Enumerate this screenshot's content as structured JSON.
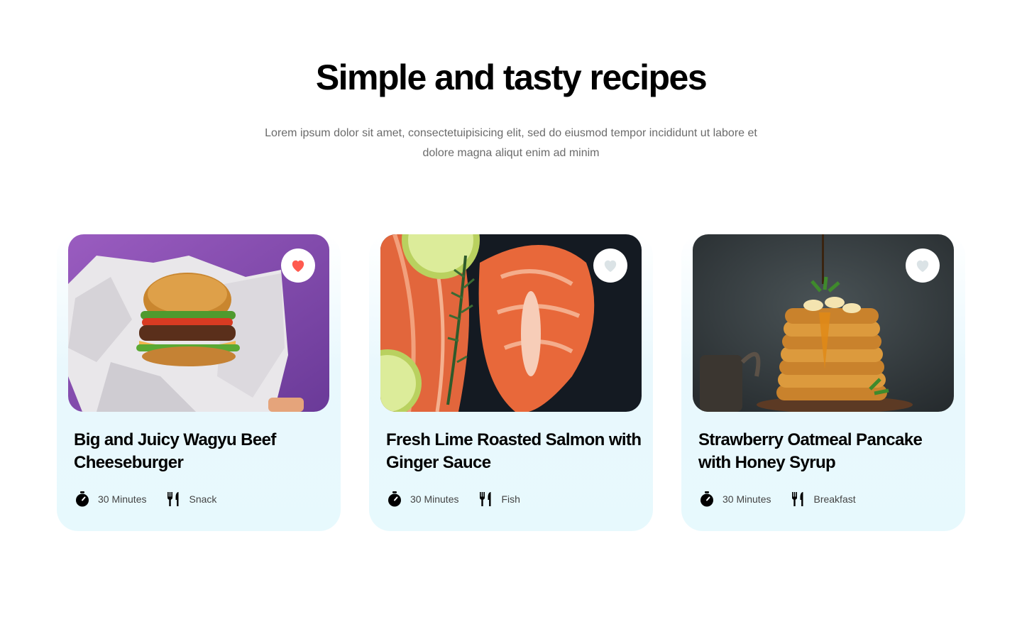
{
  "section": {
    "title": "Simple and tasty recipes",
    "subtitle": "Lorem ipsum dolor sit amet, consectetuipisicing elit, sed do eiusmod tempor incididunt ut labore et dolore magna aliqut enim ad minim"
  },
  "recipes": [
    {
      "title": "Big and Juicy Wagyu Beef Cheeseburger",
      "time": "30 Minutes",
      "category": "Snack",
      "image": "cheeseburger-photo",
      "favorited": true
    },
    {
      "title": "Fresh Lime Roasted Salmon with Ginger Sauce",
      "time": "30 Minutes",
      "category": "Fish",
      "image": "salmon-photo",
      "favorited": false
    },
    {
      "title": "Strawberry Oatmeal Pancake with Honey Syrup",
      "time": "30 Minutes",
      "category": "Breakfast",
      "image": "pancake-photo",
      "favorited": false
    }
  ],
  "icons": {
    "favorite": "heart-icon",
    "time": "timer-icon",
    "category": "fork-knife-icon"
  },
  "colors": {
    "heart_active": "#ff5a4f",
    "heart_inactive": "#dbe3e6",
    "card_bg": "#e7f9fd",
    "subtitle_text": "#6b6b6b"
  }
}
